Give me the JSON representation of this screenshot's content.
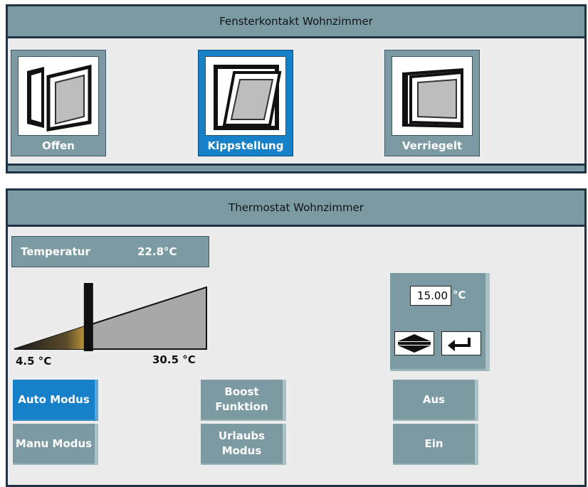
{
  "window_contact": {
    "title": "Fensterkontakt Wohnzimmer",
    "states": [
      {
        "label": "Offen",
        "icon": "window-open-icon",
        "active": false
      },
      {
        "label": "Kippstellung",
        "icon": "window-tilted-icon",
        "active": true
      },
      {
        "label": "Verriegelt",
        "icon": "window-locked-icon",
        "active": false
      }
    ],
    "accent_color": "#1680c8"
  },
  "thermostat": {
    "title": "Thermostat Wohnzimmer",
    "temperature_label": "Temperatur",
    "temperature_value": "22.8°C",
    "scale": {
      "min_label": "4.5 °C",
      "max_label": "30.5 °C",
      "min": 4.5,
      "max": 30.5,
      "current": 14.5
    },
    "setpoint": {
      "value": "15.00",
      "unit": "°C",
      "stepper_icon": "up-down-stepper-icon",
      "enter_icon": "enter-return-icon"
    },
    "buttons": {
      "auto": "Auto Modus",
      "manu": "Manu Modus",
      "boost": "Boost Funktion",
      "urlaubs": "Urlaubs Modus",
      "aus": "Aus",
      "ein": "Ein"
    },
    "active_button": "auto"
  }
}
